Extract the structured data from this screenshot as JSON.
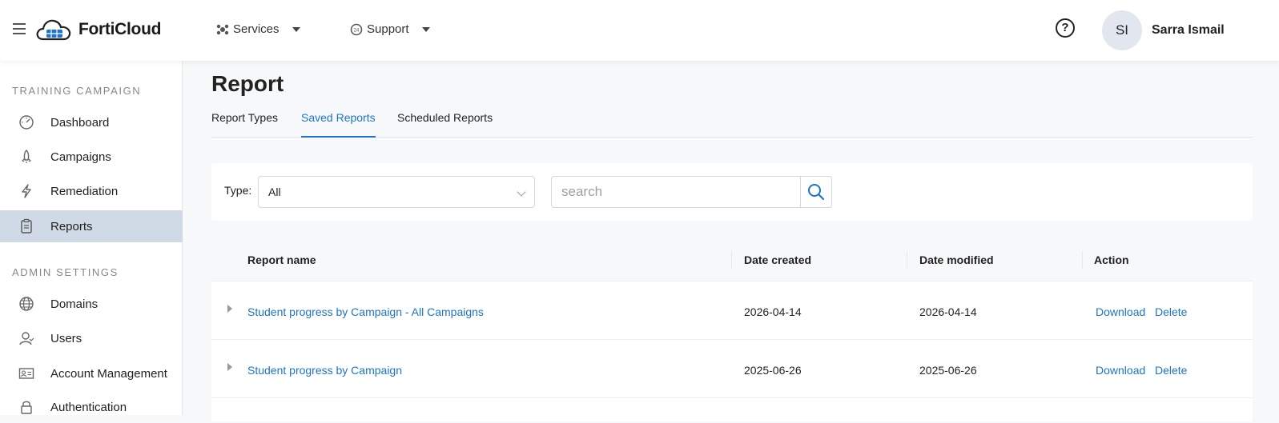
{
  "app": {
    "brand": "FortiCloud"
  },
  "topnav": {
    "services_label": "Services",
    "support_label": "Support",
    "help_icon": "?",
    "user_initials": "SI",
    "user_name": "Sarra Ismail"
  },
  "sidebar": {
    "section1_title": "TRAINING CAMPAIGN",
    "section2_title": "ADMIN SETTINGS",
    "items": [
      {
        "label": "Dashboard",
        "icon": "dashboard-icon"
      },
      {
        "label": "Campaigns",
        "icon": "rocket-icon"
      },
      {
        "label": "Remediation",
        "icon": "lightning-icon"
      },
      {
        "label": "Reports",
        "icon": "clipboard-icon",
        "active": true
      },
      {
        "label": "Domains",
        "icon": "globe-icon"
      },
      {
        "label": "Users",
        "icon": "users-icon"
      },
      {
        "label": "Account Management",
        "icon": "id-card-icon"
      },
      {
        "label": "Authentication",
        "icon": "lock-icon"
      }
    ]
  },
  "page": {
    "title": "Report",
    "tabs": [
      {
        "label": "Report Types"
      },
      {
        "label": "Saved Reports",
        "active": true
      },
      {
        "label": "Scheduled Reports"
      }
    ]
  },
  "filters": {
    "type_label": "Type:",
    "type_value": "All",
    "search_placeholder": "search"
  },
  "table": {
    "columns": [
      "Report name",
      "Date created",
      "Date modified",
      "Action"
    ],
    "rows": [
      {
        "name": "Student progress by Campaign - All Campaigns",
        "created": "2026-04-14",
        "modified": "2026-04-14",
        "actions": [
          "Download",
          "Delete"
        ]
      },
      {
        "name": "Student progress by Campaign",
        "created": "2025-06-26",
        "modified": "2025-06-26",
        "actions": [
          "Download",
          "Delete"
        ]
      }
    ]
  },
  "colors": {
    "accent": "#1e74c6",
    "active_sidebar": "#cfdae6"
  }
}
